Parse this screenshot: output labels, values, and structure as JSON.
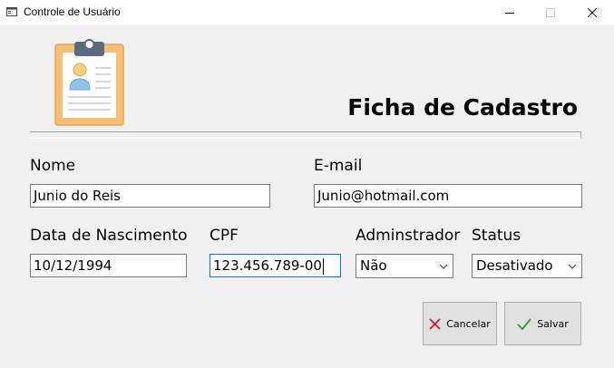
{
  "window": {
    "title": "Controle de Usuário",
    "icon": "window-form-icon"
  },
  "header": {
    "title": "Ficha de Cadastro",
    "logo": "clipboard-user-icon"
  },
  "form": {
    "nome": {
      "label": "Nome",
      "value": "Junio do Reis"
    },
    "email": {
      "label": "E-mail",
      "value": "Junio@hotmail.com"
    },
    "nascimento": {
      "label": "Data de Nascimento",
      "value": "10/12/1994"
    },
    "cpf": {
      "label": "CPF",
      "value": "123.456.789-00"
    },
    "administrador": {
      "label": "Adminstrador",
      "value": "Não"
    },
    "status": {
      "label": "Status",
      "value": "Desativado"
    }
  },
  "buttons": {
    "cancel": {
      "label": "Cancelar",
      "icon": "x-icon",
      "color": "#e81123"
    },
    "save": {
      "label": "Salvar",
      "icon": "check-icon",
      "color": "#2e9b2e"
    }
  },
  "colors": {
    "focus": "#0078d7",
    "logo_board": "#f6bf75",
    "logo_paper": "#ffffff",
    "logo_clip": "#5a6b80"
  }
}
